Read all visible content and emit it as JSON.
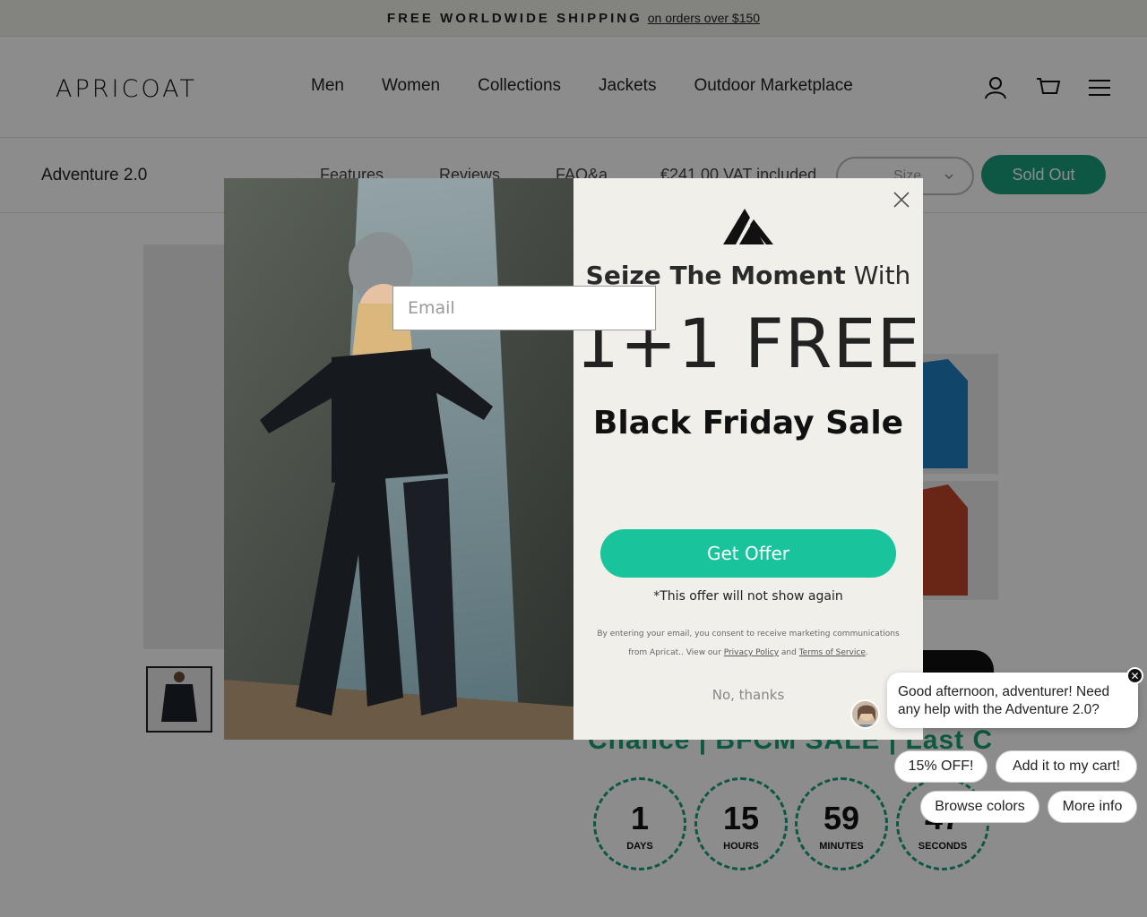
{
  "announcement": {
    "main": "FREE WORLDWIDE SHIPPING",
    "sub": "on orders over $150"
  },
  "header": {
    "logo": "APRICOAT",
    "nav": [
      "Men",
      "Women",
      "Collections",
      "Jackets",
      "Outdoor Marketplace"
    ],
    "icons": [
      "account-icon",
      "cart-icon",
      "menu-icon"
    ]
  },
  "sticky_bar": {
    "product_title": "Adventure 2.0",
    "links": [
      "Features",
      "Reviews",
      "FAQ&a"
    ],
    "price": "€241,00 VAT included",
    "size_placeholder": "Size",
    "sold_out": "Sold Out"
  },
  "page": {
    "sale_banner": "Chance | BFCM SALE | Last Chance",
    "countdown": [
      {
        "value": "1",
        "label": "DAYS"
      },
      {
        "value": "15",
        "label": "HOURS"
      },
      {
        "value": "59",
        "label": "MINUTES"
      },
      {
        "value": "47",
        "label": "SECONDS"
      }
    ]
  },
  "popup": {
    "headline_bold": "Seize The Moment",
    "headline_rest": " With",
    "big_offer": "1+1 FREE",
    "sale_title": "Black Friday Sale",
    "email_placeholder": "Email",
    "cta": "Get Offer",
    "note": "*This offer will not show again",
    "legal_prefix": "By entering your email, you consent to receive marketing communications from Apricat.. View our ",
    "privacy": "Privacy Policy",
    "and": " and ",
    "terms": "Terms of Service",
    "legal_suffix": ".",
    "dismiss": "No, thanks"
  },
  "chat": {
    "message": "Good afternoon, adventurer! Need any help with the Adventure 2.0?",
    "close_glyph": "✕",
    "chips": [
      "15% OFF!",
      "Add it to my cart!",
      "Browse colors",
      "More info"
    ]
  },
  "colors": {
    "accent_green": "#19c49c",
    "sold_out_green": "#1b9e7f",
    "jacket_blue": "#1f7fc0",
    "jacket_orange": "#c0452a"
  }
}
